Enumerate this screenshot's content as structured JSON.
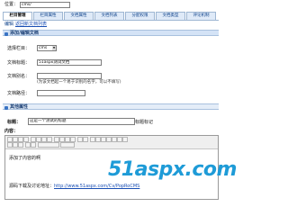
{
  "location": {
    "label": "位置：",
    "value": "cms/"
  },
  "tabs": [
    {
      "label": "栏目管理",
      "active": true
    },
    {
      "label": "栏目属性",
      "active": false
    },
    {
      "label": "文档属性",
      "active": false
    },
    {
      "label": "文档列表",
      "active": false
    },
    {
      "label": "分配权限",
      "active": false
    },
    {
      "label": "文档类型",
      "active": false
    },
    {
      "label": "评论机制",
      "active": false
    }
  ],
  "subtabs": {
    "first": "编辑",
    "link": "返回新文档列表"
  },
  "section1": {
    "title": "添加/编辑文档"
  },
  "form": {
    "column_label": "选择栏目：",
    "column_value": "cms",
    "doc_name_label": "文档标题：",
    "doc_name_value": "51aspx测试文档",
    "doc_alias_label": "文档别名：",
    "doc_alias_value": "",
    "alias_note": "(为该文档起一个易于识别的名字，可以不填写)",
    "path_label": "文档路径：",
    "path_value": ""
  },
  "section2": {
    "title": "其他属性"
  },
  "title_field": {
    "label": "标题：",
    "value": "这是一个测试的标题",
    "note": "标题标记"
  },
  "content": {
    "label": "内容：",
    "line1": "添加了内容的啊",
    "line2_prefix": "源码下载及讨论地址：",
    "line2_link": "http://www.51aspx.com/Cv/PopRoCMS"
  },
  "watermark": {
    "text": ".com"
  },
  "colors": {
    "tab_bg": "#dfeaf8",
    "section_bg": "#d4e3f6",
    "link": "#1a4fb4",
    "watermark": "#1e9bd7"
  }
}
